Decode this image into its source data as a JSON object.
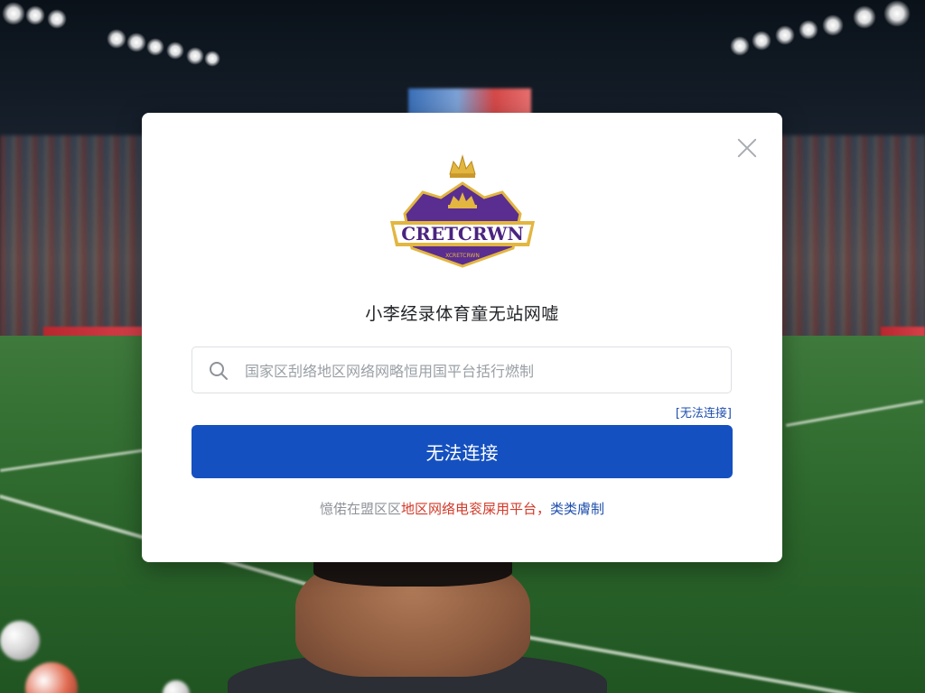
{
  "background": {
    "scene": "stadium-night-match",
    "pitch_color": "#2f6a2e",
    "adboard_color": "#c9303a"
  },
  "modal": {
    "close_icon": "close-icon",
    "logo": {
      "text": "CRETCRWN",
      "subtext": "XCRETCRWN",
      "crown_icon": "crown-icon",
      "colors": {
        "purple": "#5a2d91",
        "gold": "#e2b640"
      }
    },
    "subtitle": "小李经录体育童无站网嘘",
    "search": {
      "icon": "search-icon",
      "placeholder": "国家区刮络地区网络网略恒用国平台括行燃制",
      "value": ""
    },
    "link_label": "[无法连接]",
    "primary_button_label": "无法连接",
    "footer": {
      "gray_text": "憶偌在盟区区",
      "red_text": "地区网络电衮屎用平台，",
      "blue_text": "类类膚制"
    },
    "accent_color": "#1450c0"
  }
}
